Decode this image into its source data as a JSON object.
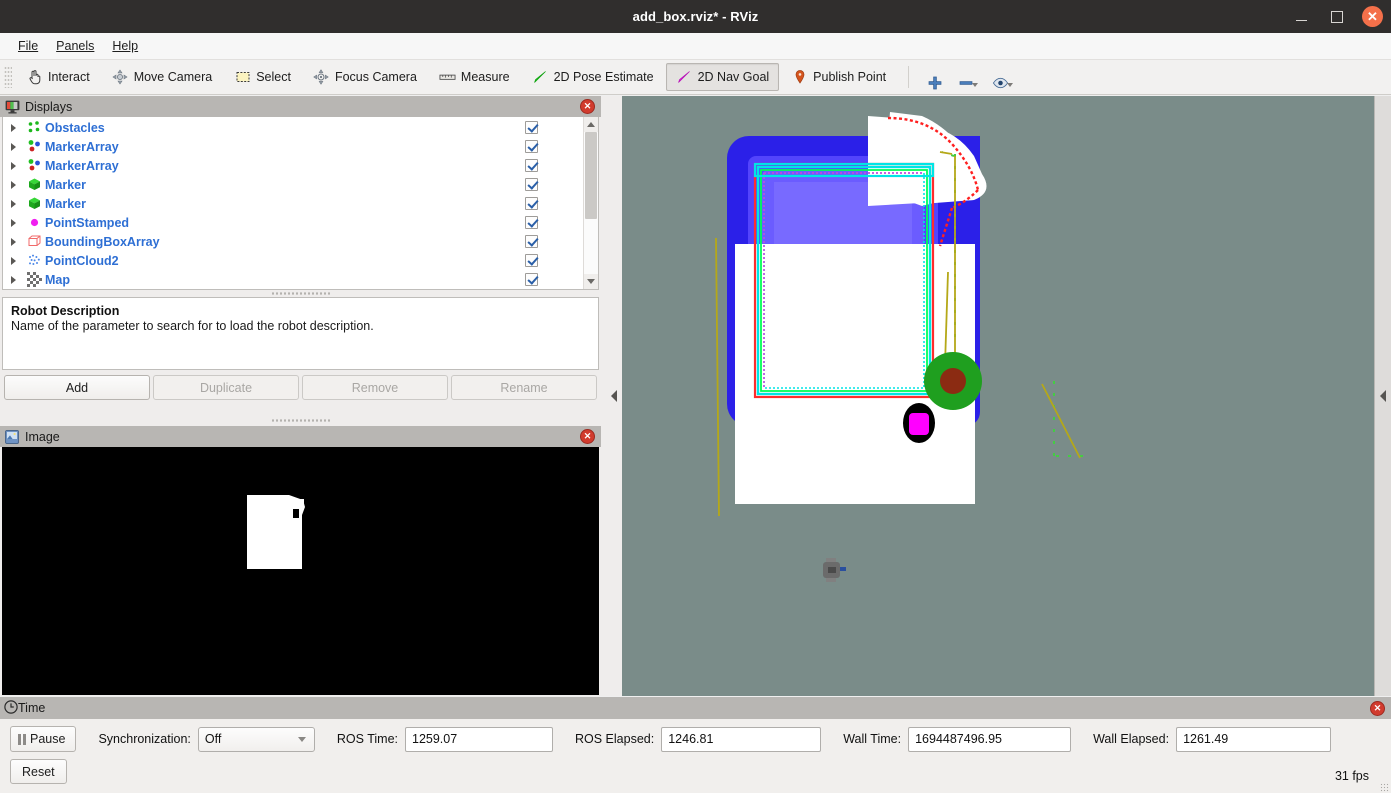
{
  "window": {
    "title": "add_box.rviz* - RViz",
    "minimize_label": "",
    "maximize_label": "",
    "close_label": "✕"
  },
  "menubar": {
    "items": [
      {
        "label": "File"
      },
      {
        "label": "Panels"
      },
      {
        "label": "Help"
      }
    ]
  },
  "toolbar": {
    "tools": [
      {
        "label": "Interact",
        "icon": "hand-cursor-icon",
        "checked": false
      },
      {
        "label": "Move Camera",
        "icon": "move-camera-icon",
        "checked": false
      },
      {
        "label": "Select",
        "icon": "select-rect-icon",
        "checked": false
      },
      {
        "label": "Focus Camera",
        "icon": "focus-camera-icon",
        "checked": false
      },
      {
        "label": "Measure",
        "icon": "ruler-icon",
        "checked": false
      },
      {
        "label": "2D Pose Estimate",
        "icon": "green-arrow-icon",
        "checked": false
      },
      {
        "label": "2D Nav Goal",
        "icon": "magenta-arrow-icon",
        "checked": true
      },
      {
        "label": "Publish Point",
        "icon": "map-pin-icon",
        "checked": false
      }
    ],
    "extra_icons": [
      {
        "name": "plus-icon",
        "has_dropdown": false
      },
      {
        "name": "minus-icon",
        "has_dropdown": true
      },
      {
        "name": "eye-icon",
        "has_dropdown": true
      }
    ]
  },
  "displays_panel": {
    "title": "Displays",
    "header_icon": "displays-monitor-icon",
    "close_icon": "close-icon",
    "items": [
      {
        "label": "Obstacles",
        "icon": "pointcloud-icon",
        "checked": true
      },
      {
        "label": "MarkerArray",
        "icon": "marker-array-icon",
        "checked": true
      },
      {
        "label": "MarkerArray",
        "icon": "marker-array-icon",
        "checked": true
      },
      {
        "label": "Marker",
        "icon": "marker-cube-icon",
        "checked": true
      },
      {
        "label": "Marker",
        "icon": "marker-cube-icon",
        "checked": true
      },
      {
        "label": "PointStamped",
        "icon": "point-stamped-icon",
        "checked": true
      },
      {
        "label": "BoundingBoxArray",
        "icon": "bounding-box-icon",
        "checked": true
      },
      {
        "label": "PointCloud2",
        "icon": "pointcloud2-icon",
        "checked": true
      },
      {
        "label": "Map",
        "icon": "map-grid-icon",
        "checked": true
      }
    ],
    "description": {
      "title": "Robot Description",
      "text": "Name of the parameter to search for to load the robot description."
    },
    "buttons": [
      {
        "label": "Add",
        "enabled": true
      },
      {
        "label": "Duplicate",
        "enabled": false
      },
      {
        "label": "Remove",
        "enabled": false
      },
      {
        "label": "Rename",
        "enabled": false
      }
    ]
  },
  "image_panel": {
    "title": "Image",
    "header_icon": "image-icon",
    "close_icon": "close-icon"
  },
  "time_panel": {
    "title": "Time",
    "header_icon": "clock-icon",
    "close_icon": "close-icon",
    "pause_label": "Pause",
    "sync_label": "Synchronization:",
    "sync_value": "Off",
    "fields": [
      {
        "label": "ROS Time:",
        "value": "1259.07"
      },
      {
        "label": "ROS Elapsed:",
        "value": "1246.81"
      },
      {
        "label": "Wall Time:",
        "value": "1694487496.95"
      },
      {
        "label": "Wall Elapsed:",
        "value": "1261.49"
      }
    ],
    "reset_label": "Reset",
    "fps": "31 fps"
  },
  "viewport": {
    "background_color": "#7a8c89",
    "map_free_color": "#ffffff",
    "costmap_inflation_color": "#2b20e8",
    "global_plan_color": "#00e5e5",
    "local_plan_color": "#00ff55",
    "footprint_color": "#ff2d2d",
    "goal_marker_outer_color": "#1f9f1f",
    "goal_marker_inner_color": "#8b2b12",
    "point_stamped_color": "#ff00ff",
    "laser_scan_color": "#44cc44",
    "obstacle_line_color": "#b5a818",
    "robot_color": "#6b6b6b"
  }
}
